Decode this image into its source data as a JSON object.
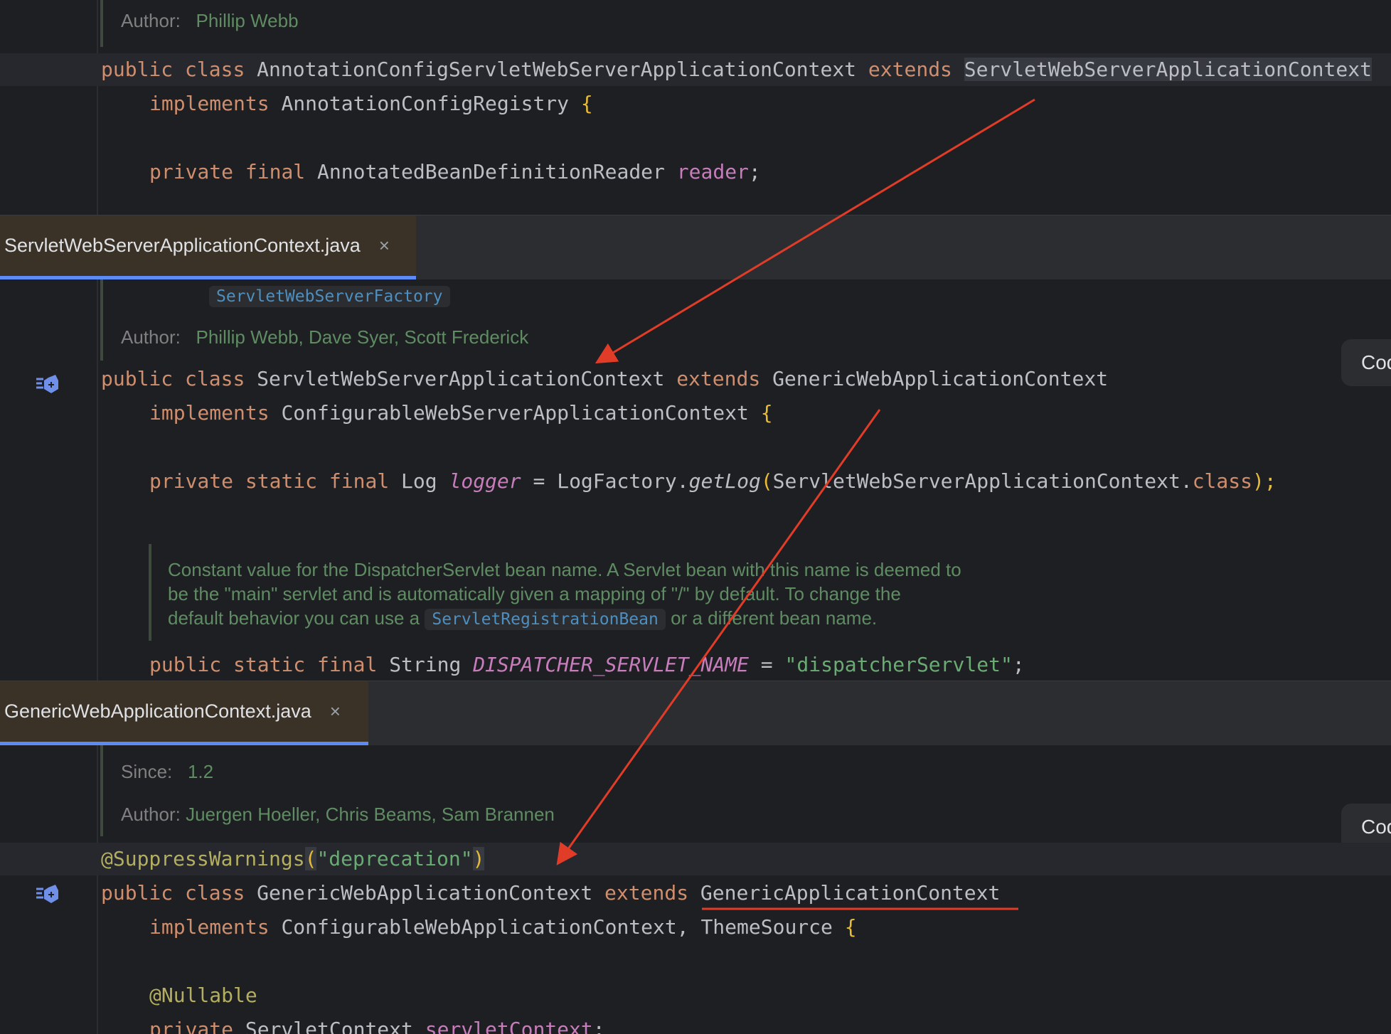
{
  "pane1": {
    "author_label": "Author:",
    "author_value": "Phillip Webb",
    "line1": {
      "kw1": "public",
      "kw2": "class",
      "name": "AnnotationConfigServletWebServerApplicationContext",
      "kw3": "extends",
      "parent": "ServletWebServerApplicationContext"
    },
    "line2": {
      "kw": "implements",
      "iface": "AnnotationConfigRegistry",
      "brace": "{"
    },
    "line3": {
      "kw1": "private",
      "kw2": "final",
      "type": "AnnotatedBeanDefinitionReader",
      "field": "reader",
      "semi": ";"
    }
  },
  "pane2": {
    "tab_label": "ServletWebServerApplicationContext.java",
    "tab_close": "×",
    "doc_ref": "ServletWebServerFactory",
    "author_label": "Author:",
    "author_value": "Phillip Webb, Dave Syer, Scott Frederick",
    "side_button": "Cod",
    "line1": {
      "kw1": "public",
      "kw2": "class",
      "name": "ServletWebServerApplicationContext",
      "kw3": "extends",
      "parent": "GenericWebApplicationContext"
    },
    "line2": {
      "kw": "implements",
      "iface": "ConfigurableWebServerApplicationContext",
      "brace": "{"
    },
    "line3": {
      "kw1": "private",
      "kw2": "static",
      "kw3": "final",
      "type": "Log",
      "field": "logger",
      "eq": " = ",
      "cls": "LogFactory.",
      "method": "getLog",
      "open": "(",
      "arg": "ServletWebServerApplicationContext.",
      "argkw": "class",
      "close": ");"
    },
    "doc_line1": "Constant value for the DispatcherServlet bean name. A Servlet bean with this name is deemed to",
    "doc_line2": "be the \"main\" servlet and is automatically given a mapping of \"/\" by default. To change the",
    "doc_line3a": "default behavior you can use a ",
    "doc_line3_code": "ServletRegistrationBean",
    "doc_line3b": " or a different bean name.",
    "line4": {
      "kw1": "public",
      "kw2": "static",
      "kw3": "final",
      "type": "String",
      "field": "DISPATCHER_SERVLET_NAME",
      "eq": " = ",
      "value": "\"dispatcherServlet\"",
      "semi": ";"
    }
  },
  "pane3": {
    "tab_label": "GenericWebApplicationContext.java",
    "tab_close": "×",
    "since_label": "Since:",
    "since_value": "1.2",
    "author_label": "Author:",
    "author_value": "Juergen Hoeller, Chris Beams, Sam Brannen",
    "side_button": "Cod",
    "annotation": {
      "name": "@SuppressWarnings",
      "open": "(",
      "value": "\"deprecation\"",
      "close": ")"
    },
    "line1": {
      "kw1": "public",
      "kw2": "class",
      "name": "GenericWebApplicationContext",
      "kw3": "extends",
      "parent": "GenericApplicationContext"
    },
    "line2": {
      "kw": "implements",
      "iface": "ConfigurableWebApplicationContext, ThemeSource",
      "brace": "{"
    },
    "line3": {
      "ann": "@Nullable"
    },
    "line4": {
      "kw": "private",
      "type": "ServletContext",
      "field": "servletContext",
      "semi": ";"
    }
  },
  "colors": {
    "background": "#1e1f22",
    "keyword": "#cf8e6d",
    "field": "#c77dbb",
    "string": "#6aab73",
    "annotation": "#b3ae60",
    "brace": "#e8ba36",
    "tab_underline": "#5c8bf5",
    "arrow": "#e03c28"
  }
}
